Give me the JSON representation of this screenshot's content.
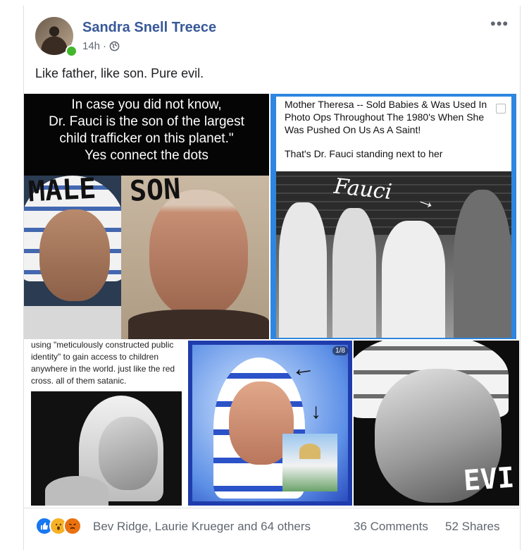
{
  "post": {
    "author": "Sandra Snell Treece",
    "time": "14h",
    "privacy_icon": "globe-icon",
    "more_icon": "ellipsis-icon",
    "text": "Like father, like son. Pure evil."
  },
  "media": {
    "img1": {
      "caption_lines": [
        "In case you did not know,",
        "Dr. Fauci is the son of the largest",
        "child trafficker on this planet.\"",
        "Yes connect the dots"
      ],
      "left_label": "MALE",
      "right_label": "SON"
    },
    "img2": {
      "caption_line1": "Mother Theresa -- Sold Babies & Was Used In",
      "caption_line2": "Photo Ops Throughout The 1980's When She",
      "caption_line3": "Was Pushed On Us As A Saint!",
      "caption_line4": "That's Dr. Fauci standing next to her",
      "handwritten": "Fauci"
    },
    "img3": {
      "caption_line1": "using \"meticulously constructed public",
      "caption_line2": "identity\" to gain access to children",
      "caption_line3": "anywhere in the world. just like the red",
      "caption_line4": "cross. all of them satanic."
    },
    "img4": {
      "counter": "1/8"
    },
    "img5": {
      "handwritten": "EVI"
    }
  },
  "footer": {
    "reactions": [
      "like-icon",
      "wow-icon",
      "angry-icon"
    ],
    "reaction_names": "Bev Ridge, Laurie Krueger and 64 others",
    "comments": "36 Comments",
    "shares": "52 Shares"
  },
  "colors": {
    "author_link": "#385898",
    "secondary_text": "#606770",
    "online_dot": "#42b72a",
    "like_blue": "#1877f2",
    "media_border_blue": "#2e86e0"
  }
}
